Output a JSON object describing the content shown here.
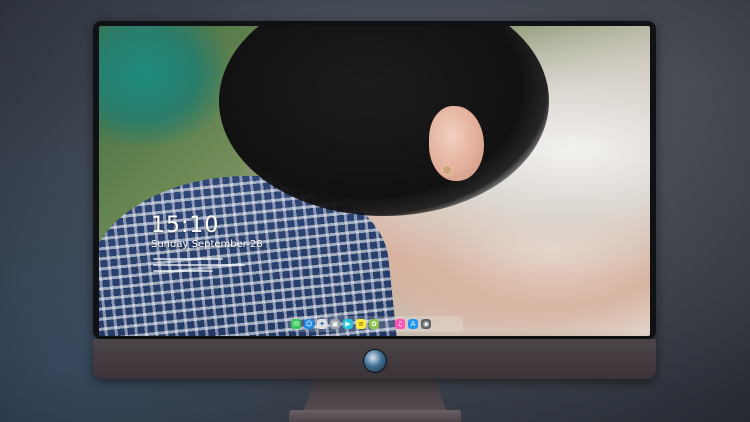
{
  "lock_screen": {
    "time": "15:10",
    "date": "Sunday September 28"
  },
  "dock": {
    "apps": [
      {
        "name": "messages-icon",
        "color": "#34c759"
      },
      {
        "name": "finder-icon",
        "color": "#1e88e5"
      },
      {
        "name": "safari-icon",
        "color": "#e0e0e0"
      },
      {
        "name": "preview-icon",
        "color": "#9aa0a6"
      },
      {
        "name": "claquette-icon",
        "color": "#26c6da"
      },
      {
        "name": "notes-icon",
        "color": "#ffeb3b"
      },
      {
        "name": "photos-icon",
        "color": "#8bc34a"
      },
      {
        "name": "itunes-icon",
        "color": "#ff4fb8"
      },
      {
        "name": "app-store-icon",
        "color": "#2196f3"
      },
      {
        "name": "camera-icon",
        "color": "#5f6368"
      }
    ]
  },
  "monitor": {
    "bezel_color": "#101114",
    "chin_color": "#463f43"
  }
}
